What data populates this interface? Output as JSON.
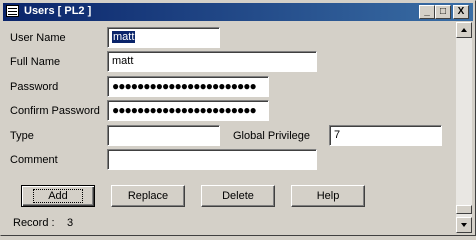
{
  "window": {
    "title": "Users [ PL2 ]",
    "minimize_glyph": "_",
    "maximize_glyph": "□",
    "close_glyph": "X"
  },
  "form": {
    "user_name_label": "User Name",
    "user_name_value": "matt",
    "full_name_label": "Full Name",
    "full_name_value": "matt",
    "password_label": "Password",
    "password_value": "●●●●●●●●●●●●●●●●●●●●●●●",
    "confirm_password_label": "Confirm Password",
    "confirm_password_value": "●●●●●●●●●●●●●●●●●●●●●●●",
    "type_label": "Type",
    "type_value": "",
    "global_privilege_label": "Global Privilege",
    "global_privilege_value": "7",
    "comment_label": "Comment",
    "comment_value": ""
  },
  "buttons": {
    "add": "Add",
    "replace": "Replace",
    "delete": "Delete",
    "help": "Help"
  },
  "status": {
    "record_label": "Record :",
    "record_value": "3"
  },
  "icons": {
    "window_icon": "window-app-icon",
    "scroll_up": "scroll-up-arrow-icon",
    "scroll_down": "scroll-down-arrow-icon"
  },
  "colors": {
    "titlebar_start": "#0a246a",
    "titlebar_end": "#3a6ea5",
    "face": "#d4d0c8",
    "selection": "#0a246a"
  },
  "scrollbar": {
    "position_fraction": 0.95
  }
}
